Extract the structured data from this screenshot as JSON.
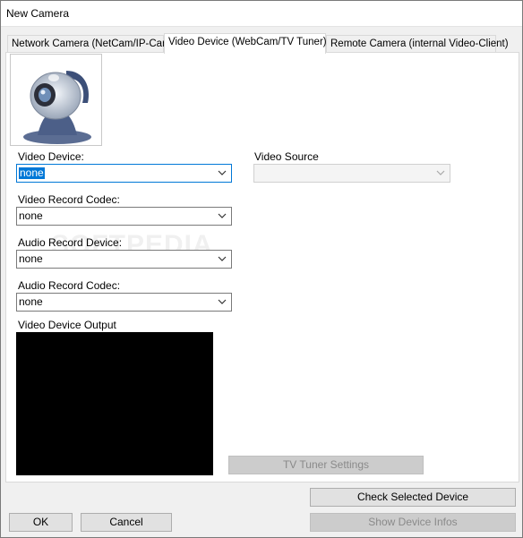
{
  "window": {
    "title": "New Camera"
  },
  "tabs": [
    {
      "label": "Network Camera (NetCam/IP-Cam)"
    },
    {
      "label": "Video Device (WebCam/TV Tuner)"
    },
    {
      "label": "Remote Camera (internal Video-Client)"
    }
  ],
  "active_tab": "Video Device (WebCam/TV Tuner)",
  "form": {
    "video_device": {
      "label": "Video Device:",
      "value": "none"
    },
    "video_source": {
      "label": "Video Source",
      "value": ""
    },
    "video_record_codec": {
      "label": "Video Record Codec:",
      "value": "none"
    },
    "audio_record_device": {
      "label": "Audio Record Device:",
      "value": "none"
    },
    "audio_record_codec": {
      "label": "Audio Record Codec:",
      "value": "none"
    },
    "video_output_label": "Video Device Output",
    "tv_tuner_button": "TV Tuner Settings"
  },
  "footer": {
    "check_device": "Check Selected Device",
    "show_infos": "Show Device Infos",
    "ok": "OK",
    "cancel": "Cancel"
  },
  "colors": {
    "accent": "#0078d7",
    "window_bg": "#f0f0f0",
    "panel_bg": "#ffffff",
    "video_bg": "#000000"
  },
  "icons": [
    "webcam-image",
    "chevron-down-icon"
  ]
}
